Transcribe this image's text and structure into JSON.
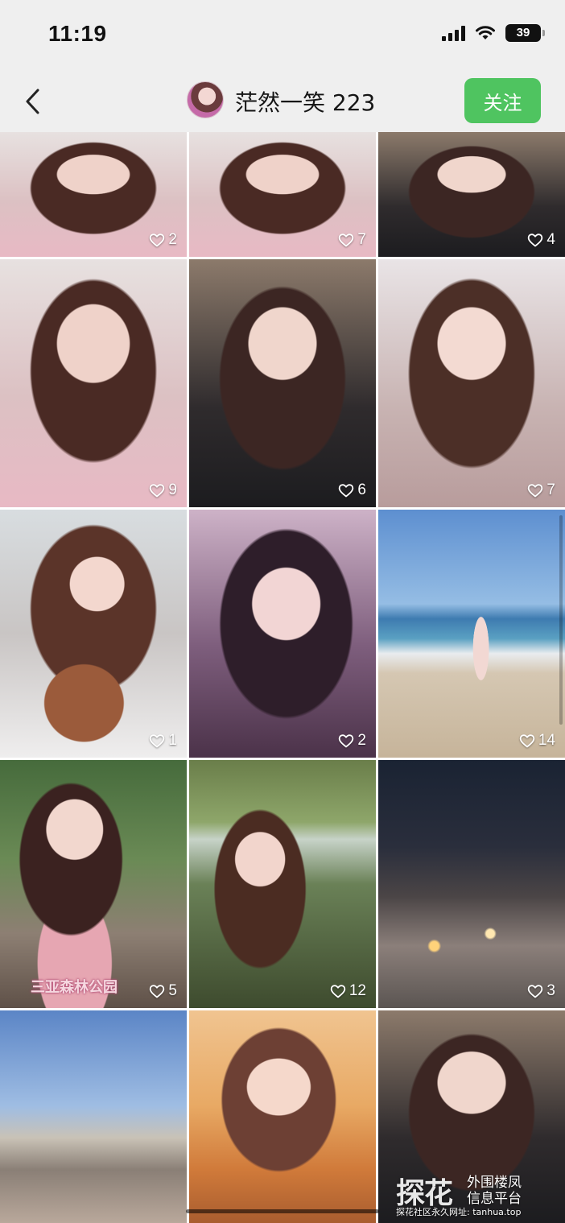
{
  "status_bar": {
    "time": "11:19",
    "battery": "39"
  },
  "header": {
    "username": "茫然一笑 223",
    "follow_label": "关注"
  },
  "posts": [
    {
      "likes": "2",
      "scene": "portrait-pink"
    },
    {
      "likes": "7",
      "scene": "portrait-pink"
    },
    {
      "likes": "4",
      "scene": "portrait-dark"
    },
    {
      "likes": "9",
      "scene": "portrait-pink"
    },
    {
      "likes": "6",
      "scene": "portrait-dark"
    },
    {
      "likes": "7",
      "scene": "portrait-mauve"
    },
    {
      "likes": "1",
      "scene": "portrait-dog"
    },
    {
      "likes": "2",
      "scene": "portrait-purple"
    },
    {
      "likes": "14",
      "scene": "beach"
    },
    {
      "likes": "5",
      "scene": "park",
      "caption": "三亚森林公园"
    },
    {
      "likes": "12",
      "scene": "waterfall"
    },
    {
      "likes": "3",
      "scene": "night-street"
    },
    {
      "likes": "",
      "scene": "dance-square"
    },
    {
      "likes": "",
      "scene": "portrait-sunset"
    },
    {
      "likes": "",
      "scene": "portrait-dark"
    }
  ],
  "watermark": {
    "brand": "探花",
    "line1": "外围楼凤",
    "line2": "信息平台",
    "footer": "探花社区永久网址: tanhua.top"
  }
}
